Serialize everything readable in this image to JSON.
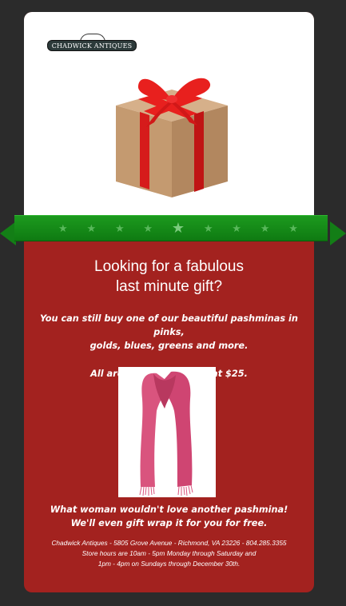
{
  "logo": {
    "text": "CHADWICK ANTIQUES"
  },
  "stars": [
    "★",
    "★",
    "★",
    "★",
    "★",
    "★",
    "★",
    "★",
    "★"
  ],
  "headline": {
    "line1": "Looking for a fabulous",
    "line2": "last minute gift?"
  },
  "intro": {
    "line1": "You can still buy one of our beautiful pashminas in pinks,",
    "line2": "golds, blues, greens and more."
  },
  "price": "All are priced just right at $25.",
  "closing": {
    "line1": "What woman wouldn't love another pashmina!",
    "line2": "We'll even gift wrap it for you for free."
  },
  "footer": {
    "line1": "Chadwick Antiques - 5805 Grove Avenue - Richmond, VA 23226 - 804.285.3355",
    "line2": "Store hours are 10am - 5pm Monday through Saturday and",
    "line3": "1pm - 4pm on Sundays through December 30th."
  },
  "colors": {
    "background": "#2b2b2b",
    "card_red": "#a3221f",
    "ribbon_green": "#12851a",
    "gift_ribbon": "#e01e1e",
    "box_kraft": "#c9a27a",
    "scarf_pink": "#d9547e"
  }
}
